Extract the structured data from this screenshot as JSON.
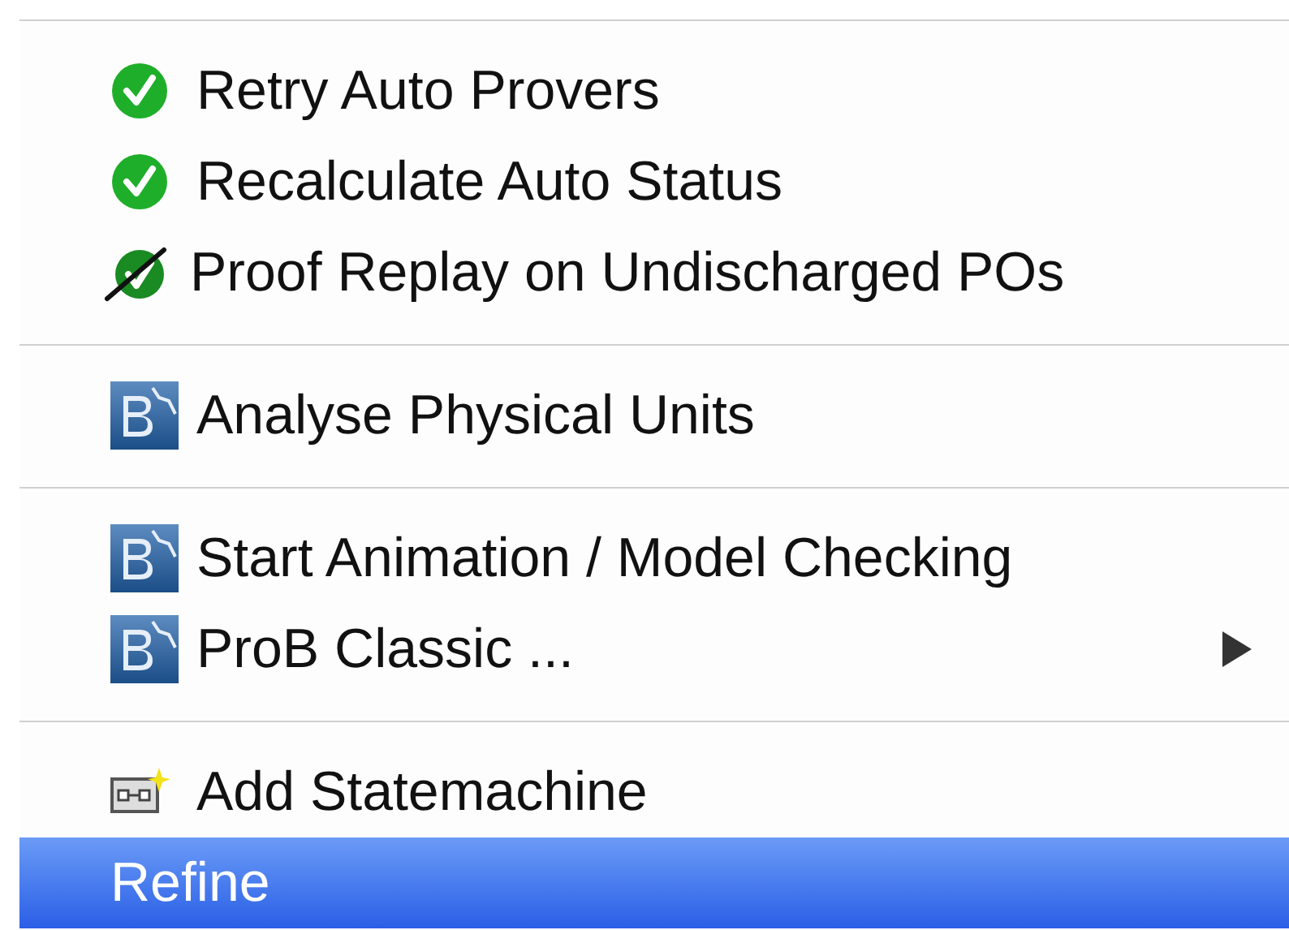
{
  "menu": {
    "items": [
      {
        "kind": "check",
        "label": "Retry Auto Provers",
        "selected": false,
        "submenu": false
      },
      {
        "kind": "check",
        "label": "Recalculate Auto Status",
        "selected": false,
        "submenu": false
      },
      {
        "kind": "crossed_check",
        "label": "Proof Replay on Undischarged POs",
        "selected": false,
        "submenu": false
      },
      {
        "kind": "separator"
      },
      {
        "kind": "b_logo",
        "label": "Analyse Physical Units",
        "selected": false,
        "submenu": false
      },
      {
        "kind": "separator"
      },
      {
        "kind": "b_logo",
        "label": "Start Animation / Model Checking",
        "selected": false,
        "submenu": false
      },
      {
        "kind": "b_logo",
        "label": "ProB Classic ...",
        "selected": false,
        "submenu": true
      },
      {
        "kind": "separator"
      },
      {
        "kind": "statemachine",
        "label": "Add Statemachine",
        "selected": false,
        "submenu": false
      },
      {
        "kind": "plain",
        "label": "Refine",
        "selected": true,
        "submenu": false
      }
    ]
  }
}
